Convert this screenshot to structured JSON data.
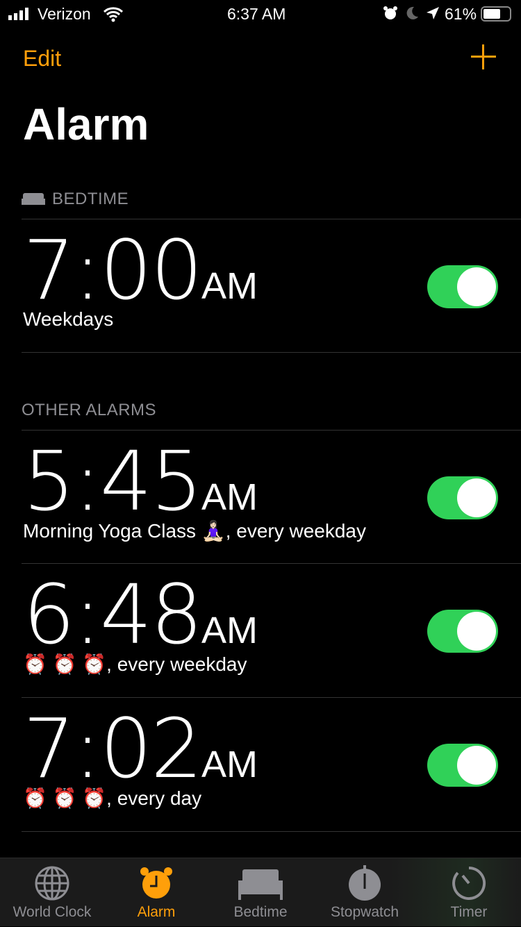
{
  "status_bar": {
    "carrier": "Verizon",
    "time": "6:37 AM",
    "battery": "61%"
  },
  "nav": {
    "edit_label": "Edit",
    "title": "Alarm"
  },
  "bedtime_section": {
    "header": "BEDTIME",
    "alarm": {
      "time": "7:00",
      "ampm": "AM",
      "label": "Weekdays",
      "enabled": true
    }
  },
  "other_section": {
    "header": "OTHER ALARMS",
    "alarms": [
      {
        "time": "5:45",
        "ampm": "AM",
        "label": "Morning Yoga Class 🧘🏻‍♀️, every weekday",
        "enabled": true
      },
      {
        "time": "6:48",
        "ampm": "AM",
        "label": "⏰ ⏰ ⏰, every weekday",
        "enabled": true
      },
      {
        "time": "7:02",
        "ampm": "AM",
        "label": "⏰ ⏰ ⏰, every day",
        "enabled": true
      }
    ]
  },
  "tabs": [
    {
      "label": "World Clock",
      "icon": "globe-icon"
    },
    {
      "label": "Alarm",
      "icon": "alarm-clock-icon",
      "active": true
    },
    {
      "label": "Bedtime",
      "icon": "bed-icon"
    },
    {
      "label": "Stopwatch",
      "icon": "stopwatch-icon"
    },
    {
      "label": "Timer",
      "icon": "timer-icon"
    }
  ],
  "colors": {
    "accent": "#ff9f0a",
    "toggle_on": "#30d158",
    "inactive": "#8e8e93"
  }
}
